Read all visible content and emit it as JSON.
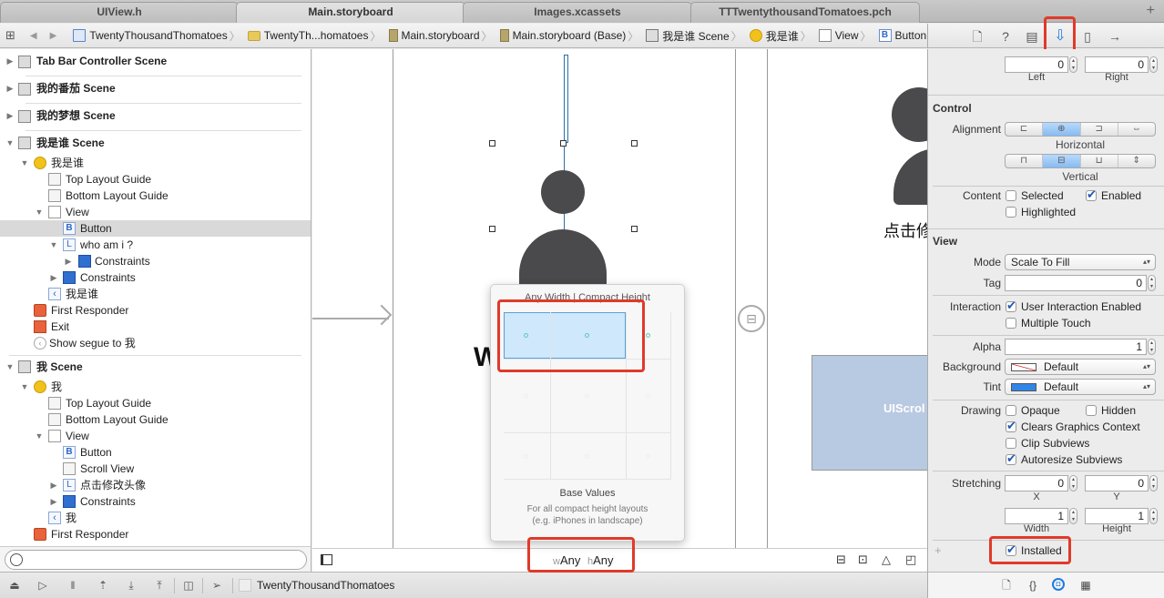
{
  "tabs": [
    {
      "label": "UIView.h",
      "active": false
    },
    {
      "label": "Main.storyboard",
      "active": true
    },
    {
      "label": "Images.xcassets",
      "active": false
    },
    {
      "label": "TTTwentythousandTomatoes.pch",
      "active": false
    }
  ],
  "tab_add": "+",
  "jumpbar": {
    "items": [
      {
        "label": "TwentyThousandThomatoes",
        "icon": "project-file-icon"
      },
      {
        "label": "TwentyTh...homatoes",
        "icon": "folder-icon"
      },
      {
        "label": "Main.storyboard",
        "icon": "storyboard-icon"
      },
      {
        "label": "Main.storyboard (Base)",
        "icon": "storyboard-icon"
      },
      {
        "label": "我是谁 Scene",
        "icon": "scene-icon"
      },
      {
        "label": "我是谁",
        "icon": "view-controller-icon"
      },
      {
        "label": "View",
        "icon": "view-icon"
      },
      {
        "label": "Button",
        "icon": "button-icon"
      }
    ],
    "separator": "〉"
  },
  "outline": {
    "scenes_collapsed": [
      "Tab Bar Controller Scene",
      "我的番茄 Scene",
      "我的梦想 Scene"
    ],
    "scene1": {
      "title": "我是谁 Scene",
      "vc": "我是谁",
      "top_guide": "Top Layout Guide",
      "bottom_guide": "Bottom Layout Guide",
      "view": "View",
      "button": "Button",
      "label": "who am i ?",
      "label_constraints": "Constraints",
      "constraints": "Constraints",
      "nav": "我是谁",
      "first_responder": "First Responder",
      "exit": "Exit",
      "segue": "Show segue to 我"
    },
    "scene2": {
      "title": "我 Scene",
      "vc": "我",
      "top_guide": "Top Layout Guide",
      "bottom_guide": "Bottom Layout Guide",
      "view": "View",
      "button": "Button",
      "scroll": "Scroll View",
      "label": "点击修改头像",
      "constraints": "Constraints",
      "nav": "我",
      "first_responder": "First Responder"
    },
    "filter_placeholder": ""
  },
  "debugbar": {
    "target": "TwentyThousandThomatoes"
  },
  "canvas": {
    "label_text": "who am i ?",
    "label_partial": "W",
    "right_label": "点击修",
    "scroll_label": "UIScrol",
    "size_class": {
      "w_prefix": "w",
      "w_value": "Any",
      "h_prefix": "h",
      "h_value": "Any"
    }
  },
  "popover": {
    "title": "Any Width | Compact Height",
    "subtitle": "Base Values",
    "desc_line1": "For all compact height layouts",
    "desc_line2": "(e.g. iPhones in landscape)"
  },
  "inspector": {
    "edge": {
      "left_value": "0",
      "right_value": "0",
      "left_label": "Left",
      "right_label": "Right"
    },
    "control": {
      "section": "Control",
      "alignment_label": "Alignment",
      "horizontal_caption": "Horizontal",
      "vertical_caption": "Vertical",
      "horizontal_selected": 1,
      "vertical_selected": 1,
      "content_label": "Content",
      "selected": {
        "label": "Selected",
        "checked": false
      },
      "enabled": {
        "label": "Enabled",
        "checked": true
      },
      "highlighted": {
        "label": "Highlighted",
        "checked": false
      }
    },
    "view": {
      "section": "View",
      "mode_label": "Mode",
      "mode_value": "Scale To Fill",
      "tag_label": "Tag",
      "tag_value": "0",
      "interaction_label": "Interaction",
      "user_interaction": {
        "label": "User Interaction Enabled",
        "checked": true
      },
      "multiple_touch": {
        "label": "Multiple Touch",
        "checked": false
      },
      "alpha_label": "Alpha",
      "alpha_value": "1",
      "background_label": "Background",
      "background_value": "Default",
      "tint_label": "Tint",
      "tint_value": "Default",
      "tint_color": "#2f86e8",
      "drawing_label": "Drawing",
      "opaque": {
        "label": "Opaque",
        "checked": false
      },
      "hidden": {
        "label": "Hidden",
        "checked": false
      },
      "clears": {
        "label": "Clears Graphics Context",
        "checked": true
      },
      "clip": {
        "label": "Clip Subviews",
        "checked": false
      },
      "autoresize": {
        "label": "Autoresize Subviews",
        "checked": true
      },
      "stretching_label": "Stretching",
      "stretch_x": "0",
      "stretch_y": "0",
      "stretch_w": "1",
      "stretch_h": "1",
      "x_label": "X",
      "y_label": "Y",
      "w_label": "Width",
      "h_label": "Height",
      "installed": {
        "label": "Installed",
        "checked": true
      },
      "add": "+"
    }
  },
  "colors": {
    "highlight_red": "#e03a2a",
    "accent_blue": "#2f86e8",
    "scroll_fill": "#b8c9e2"
  }
}
